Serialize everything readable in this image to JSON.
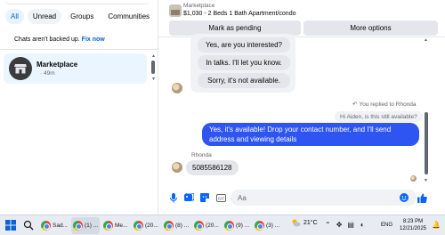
{
  "sidebar": {
    "filters": [
      "All",
      "Unread",
      "Groups",
      "Communities"
    ],
    "backup_text": "Chats aren't backed up.",
    "backup_link": "Fix now",
    "conversations": [
      {
        "title": "Marketplace",
        "time": "· 49m",
        "icon": "store-icon"
      }
    ]
  },
  "chat": {
    "listing": {
      "kicker": "Marketplace",
      "title": "$1,030 - 2 Beds 1 Bath Apartment/condo"
    },
    "actions": {
      "mark_pending": "Mark as pending",
      "more_options": "More options"
    },
    "quick_replies": [
      "Yes, are you interested?",
      "In talks. I'll let you know.",
      "Sorry, it's not available."
    ],
    "replied_note": "You replied to Rhonda",
    "quoted_message": "Hi Aiden, is this still available?",
    "outgoing_message": "Yes, it's available! Drop your contact number, and I'll send address and viewing details",
    "incoming_sender": "Rhonda",
    "incoming_message": "5085586128",
    "composer_placeholder": "Aa",
    "accent_color": "#2e55f2"
  },
  "taskbar": {
    "apps": [
      {
        "label": "Sad...",
        "icon": "chrome-icon"
      },
      {
        "label": "(1) ...",
        "icon": "chrome-icon"
      },
      {
        "label": "Me...",
        "icon": "chrome-icon"
      },
      {
        "label": "(20...",
        "icon": "chrome-icon"
      },
      {
        "label": "(8) ...",
        "icon": "chrome-icon"
      },
      {
        "label": "(20...",
        "icon": "chrome-icon"
      },
      {
        "label": "(9) ...",
        "icon": "chrome-icon"
      },
      {
        "label": "(3) ...",
        "icon": "chrome-icon"
      }
    ],
    "temperature": "21°C",
    "language": "ENG",
    "time": "8:23 PM",
    "date": "12/21/2025"
  }
}
